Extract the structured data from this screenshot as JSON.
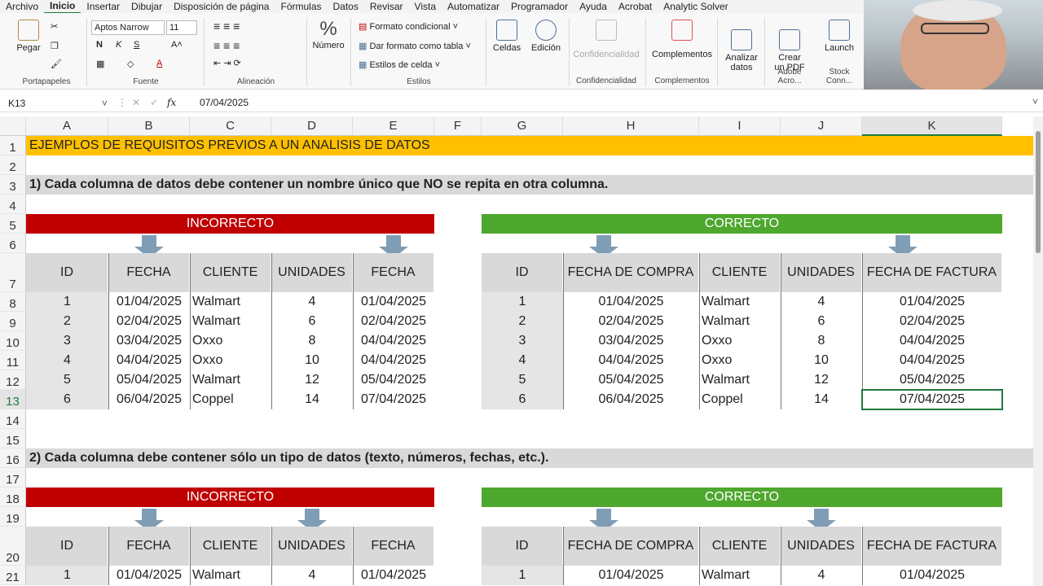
{
  "menu": [
    "Archivo",
    "Inicio",
    "Insertar",
    "Dibujar",
    "Disposición de página",
    "Fórmulas",
    "Datos",
    "Revisar",
    "Vista",
    "Automatizar",
    "Programador",
    "Ayuda",
    "Acrobat",
    "Analytic Solver"
  ],
  "ribbon": {
    "pegar": "Pegar",
    "portapapeles": "Portapapeles",
    "font_name": "Aptos Narrow",
    "font_size": "11",
    "fuente": "Fuente",
    "alineacion": "Alineación",
    "numero": "Número",
    "formato_condicional": "Formato condicional",
    "dar_formato_tabla": "Dar formato como tabla",
    "estilos_celda": "Estilos de celda",
    "estilos": "Estilos",
    "celdas": "Celdas",
    "edicion": "Edición",
    "confidencialidad_btn": "Confidencialidad",
    "confidencialidad": "Confidencialidad",
    "complementos_btn": "Complementos",
    "complementos": "Complementos",
    "analizar": "Analizar\ndatos",
    "crear_pdf": "Crear\nun PDF",
    "adobe": "Adobe Acro...",
    "launch": "Launch",
    "stock": "Stock Conn..."
  },
  "formula_bar": {
    "name_box": "K13",
    "value": "07/04/2025",
    "fx": "fx"
  },
  "columns": [
    "A",
    "B",
    "C",
    "D",
    "E",
    "F",
    "G",
    "H",
    "I",
    "J",
    "K"
  ],
  "rows": [
    "1",
    "2",
    "3",
    "4",
    "5",
    "6",
    "7",
    "8",
    "9",
    "10",
    "11",
    "12",
    "13",
    "14",
    "15",
    "16",
    "17",
    "18",
    "19",
    "20",
    "21"
  ],
  "sheet": {
    "title": "EJEMPLOS DE REQUISITOS PREVIOS A UN ANALISIS DE DATOS",
    "req1": "1) Cada columna de datos debe contener un nombre único que NO se repita en otra columna.",
    "req2": "2) Cada columna debe contener sólo un tipo de datos (texto, números, fechas, etc.).",
    "incorrecto": "INCORRECTO",
    "correcto": "CORRECTO",
    "bad_headers": [
      "ID",
      "FECHA",
      "CLIENTE",
      "UNIDADES",
      "FECHA"
    ],
    "good_headers": [
      "ID",
      "FECHA DE COMPRA",
      "CLIENTE",
      "UNIDADES",
      "FECHA DE FACTURA"
    ],
    "bad_rows": [
      [
        "1",
        "01/04/2025",
        "Walmart",
        "4",
        "01/04/2025"
      ],
      [
        "2",
        "02/04/2025",
        "Walmart",
        "6",
        "02/04/2025"
      ],
      [
        "3",
        "03/04/2025",
        "Oxxo",
        "8",
        "04/04/2025"
      ],
      [
        "4",
        "04/04/2025",
        "Oxxo",
        "10",
        "04/04/2025"
      ],
      [
        "5",
        "05/04/2025",
        "Walmart",
        "12",
        "05/04/2025"
      ],
      [
        "6",
        "06/04/2025",
        "Coppel",
        "14",
        "07/04/2025"
      ]
    ],
    "good_rows": [
      [
        "1",
        "01/04/2025",
        "Walmart",
        "4",
        "01/04/2025"
      ],
      [
        "2",
        "02/04/2025",
        "Walmart",
        "6",
        "02/04/2025"
      ],
      [
        "3",
        "03/04/2025",
        "Oxxo",
        "8",
        "04/04/2025"
      ],
      [
        "4",
        "04/04/2025",
        "Oxxo",
        "10",
        "04/04/2025"
      ],
      [
        "5",
        "05/04/2025",
        "Walmart",
        "12",
        "05/04/2025"
      ],
      [
        "6",
        "06/04/2025",
        "Coppel",
        "14",
        "07/04/2025"
      ]
    ],
    "row21_bad": [
      "1",
      "01/04/2025",
      "Walmart",
      "4",
      "01/04/2025"
    ],
    "row21_good": [
      "1",
      "01/04/2025",
      "Walmart",
      "4",
      "01/04/2025"
    ]
  },
  "colors": {
    "yellow": "#ffc000",
    "red": "#c00000",
    "green": "#4ea72e",
    "header_gray": "#d9d9d9",
    "accent": "#1f7a3d"
  }
}
